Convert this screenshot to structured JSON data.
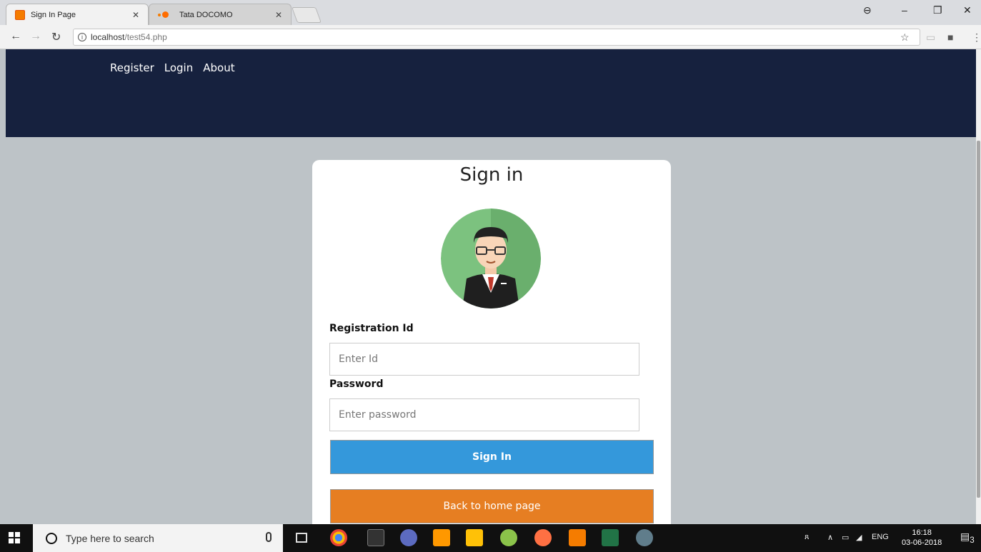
{
  "browser": {
    "tabs": [
      {
        "title": "Sign In Page",
        "active": true
      },
      {
        "title": "Tata DOCOMO",
        "active": false
      }
    ],
    "address": {
      "host": "localhost",
      "path": "/test54.php"
    }
  },
  "nav": {
    "items": [
      "Register",
      "Login",
      "About"
    ]
  },
  "form": {
    "title": "Sign in",
    "id_label": "Registration Id",
    "id_placeholder": "Enter Id",
    "password_label": "Password",
    "password_placeholder": "Enter password",
    "signin_label": "Sign In",
    "home_label": "Back to home page"
  },
  "taskbar": {
    "search_placeholder": "Type here to search",
    "lang": "ENG",
    "time": "16:18",
    "date": "03-06-2018",
    "notifications": "3"
  },
  "colors": {
    "header": "#16213e",
    "page_bg": "#bdc3c7",
    "signin_button": "#3498db",
    "home_button": "#e67e22"
  }
}
